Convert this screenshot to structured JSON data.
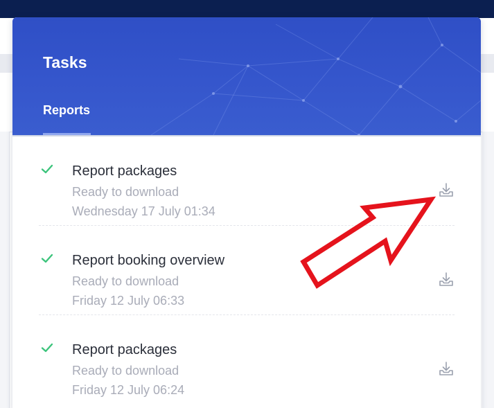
{
  "panel": {
    "title": "Tasks",
    "tabs": [
      {
        "label": "Reports",
        "active": true
      }
    ]
  },
  "tasks": [
    {
      "title": "Report packages",
      "status": "Ready to download",
      "date": "Wednesday 17 July 01:34",
      "icon": "check-icon",
      "action_icon": "download-icon"
    },
    {
      "title": "Report booking overview",
      "status": "Ready to download",
      "date": "Friday 12 July 06:33",
      "icon": "check-icon",
      "action_icon": "download-icon"
    },
    {
      "title": "Report packages",
      "status": "Ready to download",
      "date": "Friday 12 July 06:24",
      "icon": "check-icon",
      "action_icon": "download-icon"
    }
  ],
  "colors": {
    "header": "#3556cc",
    "check": "#3cc47c",
    "arrow": "#e5131c",
    "topbar": "#0b1f50"
  }
}
